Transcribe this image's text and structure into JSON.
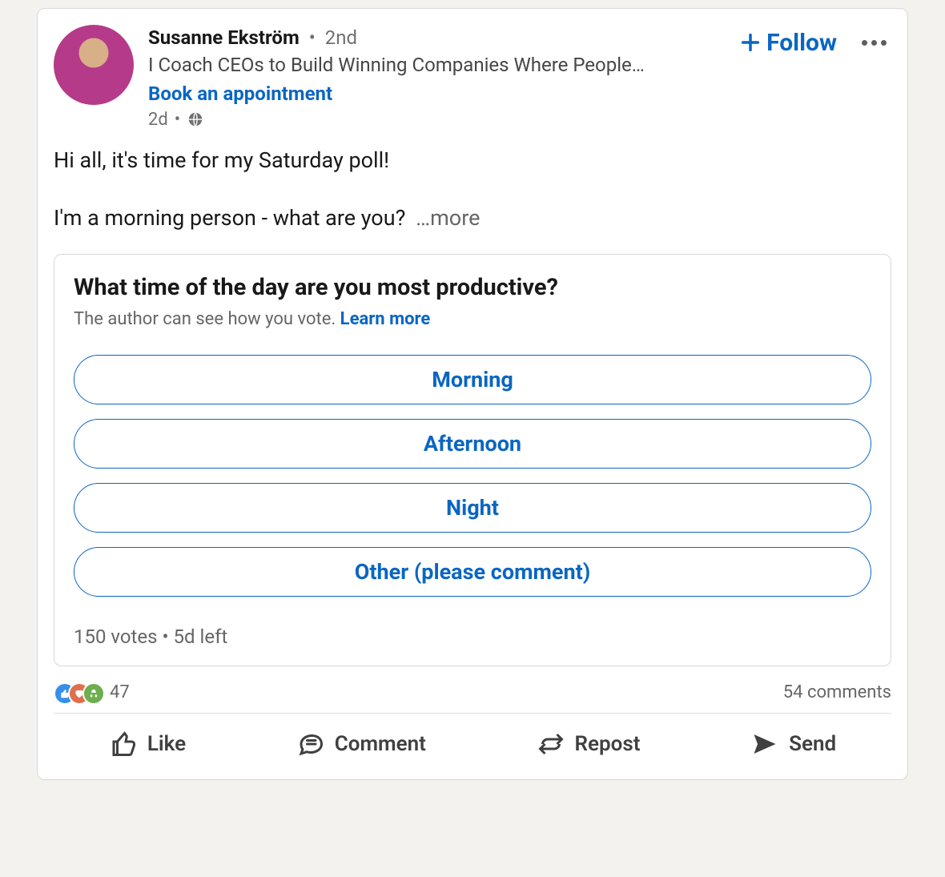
{
  "post": {
    "author": {
      "name": "Susanne Ekström",
      "degree": "2nd",
      "headline": "I Coach CEOs to Build Winning Companies Where People…",
      "cta": "Book an appointment",
      "time": "2d"
    },
    "follow_label": "Follow",
    "body": {
      "line1": "Hi all, it's time for my Saturday poll!",
      "line2": "I'm a morning person - what are you?",
      "more": "…more"
    },
    "poll": {
      "question": "What time of the day are you most productive?",
      "visibility_note": "The author can see how you vote. ",
      "learn_more": "Learn more",
      "options": [
        "Morning",
        "Afternoon",
        "Night",
        "Other (please comment)"
      ],
      "votes": "150 votes",
      "time_left": "5d left"
    },
    "stats": {
      "reactions_count": "47",
      "comments": "54 comments"
    },
    "actions": {
      "like": "Like",
      "comment": "Comment",
      "repost": "Repost",
      "send": "Send"
    }
  }
}
